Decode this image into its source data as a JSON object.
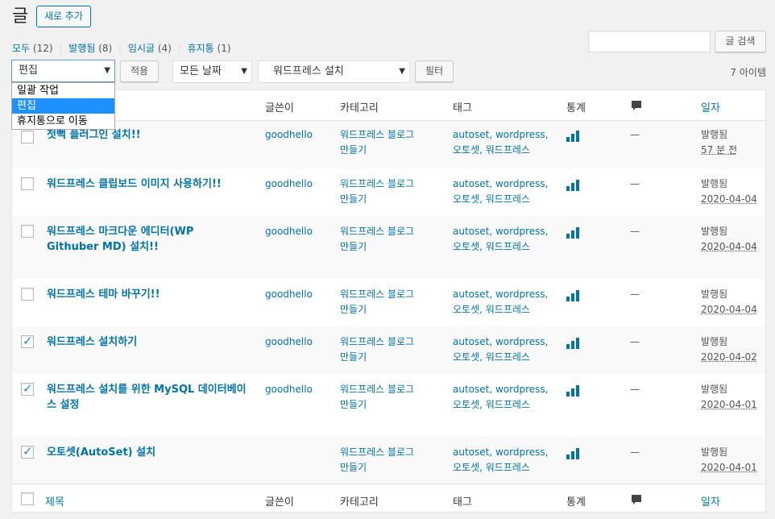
{
  "header": {
    "title": "글",
    "add_new": "새로 추가"
  },
  "views": [
    {
      "label": "모두",
      "count": "(12)"
    },
    {
      "label": "발행됨",
      "count": "(8)"
    },
    {
      "label": "임시글",
      "count": "(4)"
    },
    {
      "label": "휴지통",
      "count": "(1)"
    }
  ],
  "search": {
    "button": "글 검색",
    "value": ""
  },
  "toolbar": {
    "bulk_selected": "편집",
    "bulk_options": [
      "일괄 작업",
      "편집",
      "휴지통으로 이동"
    ],
    "apply": "적용",
    "date_filter": "모든 날짜",
    "category_filter": "워드프레스 설치",
    "filter": "필터",
    "items_count": "7 아이템"
  },
  "columns": {
    "author": "글쓴이",
    "categories": "카테고리",
    "tags": "태그",
    "stats": "통계",
    "date": "일자",
    "title": "제목"
  },
  "posts": [
    {
      "title": "첫뻑 플러그인 설치!!",
      "author": "goodhello",
      "cat1": "워드프레스 블로그",
      "cat2": "만들기",
      "tag1": "autoset, wordpress,",
      "tag2": "오토셋, 워드프레스",
      "comments": "—",
      "status": "발행됨",
      "date": "57 분 전",
      "checked": false
    },
    {
      "title": "워드프레스 클립보드 이미지 사용하기!!",
      "author": "goodhello",
      "cat1": "워드프레스 블로그",
      "cat2": "만들기",
      "tag1": "autoset, wordpress,",
      "tag2": "오토셋, 워드프레스",
      "comments": "—",
      "status": "발행됨",
      "date": "2020-04-04",
      "checked": false
    },
    {
      "title": "워드프레스 마크다운 에디터(WP Githuber MD) 설치!!",
      "author": "goodhello",
      "cat1": "워드프레스 블로그",
      "cat2": "만들기",
      "tag1": "autoset, wordpress,",
      "tag2": "오토셋, 워드프레스",
      "comments": "—",
      "status": "발행됨",
      "date": "2020-04-04",
      "checked": false
    },
    {
      "title": "워드프레스 테마 바꾸기!!",
      "author": "goodhello",
      "cat1": "워드프레스 블로그",
      "cat2": "만들기",
      "tag1": "autoset, wordpress,",
      "tag2": "오토셋, 워드프레스",
      "comments": "—",
      "status": "발행됨",
      "date": "2020-04-04",
      "checked": false
    },
    {
      "title": "워드프레스 설치하기",
      "author": "goodhello",
      "cat1": "워드프레스 블로그",
      "cat2": "만들기",
      "tag1": "autoset, wordpress,",
      "tag2": "오토셋, 워드프레스",
      "comments": "—",
      "status": "발행됨",
      "date": "2020-04-02",
      "checked": true
    },
    {
      "title": "워드프레스 설치를 위한 MySQL 데이터베이스 설정",
      "author": "goodhello",
      "cat1": "워드프레스 블로그",
      "cat2": "만들기",
      "tag1": "autoset, wordpress,",
      "tag2": "오토셋, 워드프레스",
      "comments": "—",
      "status": "발행됨",
      "date": "2020-04-01",
      "checked": true
    },
    {
      "title": "오토셋(AutoSet) 설치",
      "author": "",
      "cat1": "워드프레스 블로그",
      "cat2": "만들기",
      "tag1": "autoset, wordpress,",
      "tag2": "오토셋, 워드프레스",
      "comments": "—",
      "status": "발행됨",
      "date": "2020-04-01",
      "checked": true
    }
  ]
}
